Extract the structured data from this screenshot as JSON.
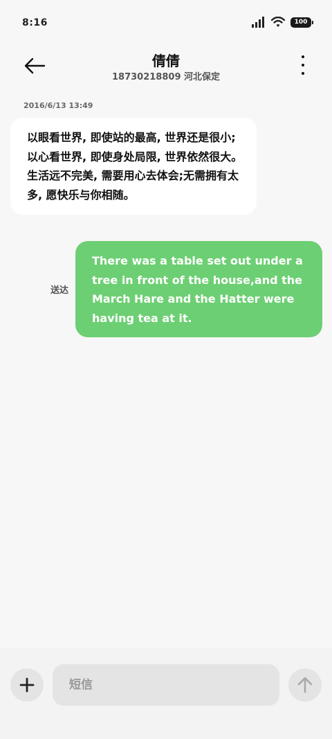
{
  "status_bar": {
    "time": "8:16",
    "battery": "100",
    "icons": [
      "signal-icon",
      "wifi-icon",
      "battery-icon"
    ]
  },
  "header": {
    "contact_name": "倩倩",
    "contact_info": "18730218809 河北保定",
    "icons": [
      "back-arrow-icon",
      "more-vertical-icon"
    ]
  },
  "conversation": {
    "timestamp": "2016/6/13 13:49",
    "received_message": "以眼看世界, 即使站的最高, 世界还是很小;以心看世界, 即使身处局限, 世界依然很大。生活远不完美, 需要用心去体会;无需拥有太多, 愿快乐与你相随。",
    "sent_status": "送达",
    "sent_message": "There was a table set out under a tree in front of the house,and the March Hare and the Hatter were having tea at it."
  },
  "composer": {
    "placeholder": "短信",
    "value": "",
    "icons": [
      "plus-icon",
      "send-arrow-up-icon"
    ]
  },
  "colors": {
    "background": "#f7f7f7",
    "received_bubble": "#ffffff",
    "sent_bubble": "#6dcf73",
    "input_background": "#e4e4e4"
  }
}
